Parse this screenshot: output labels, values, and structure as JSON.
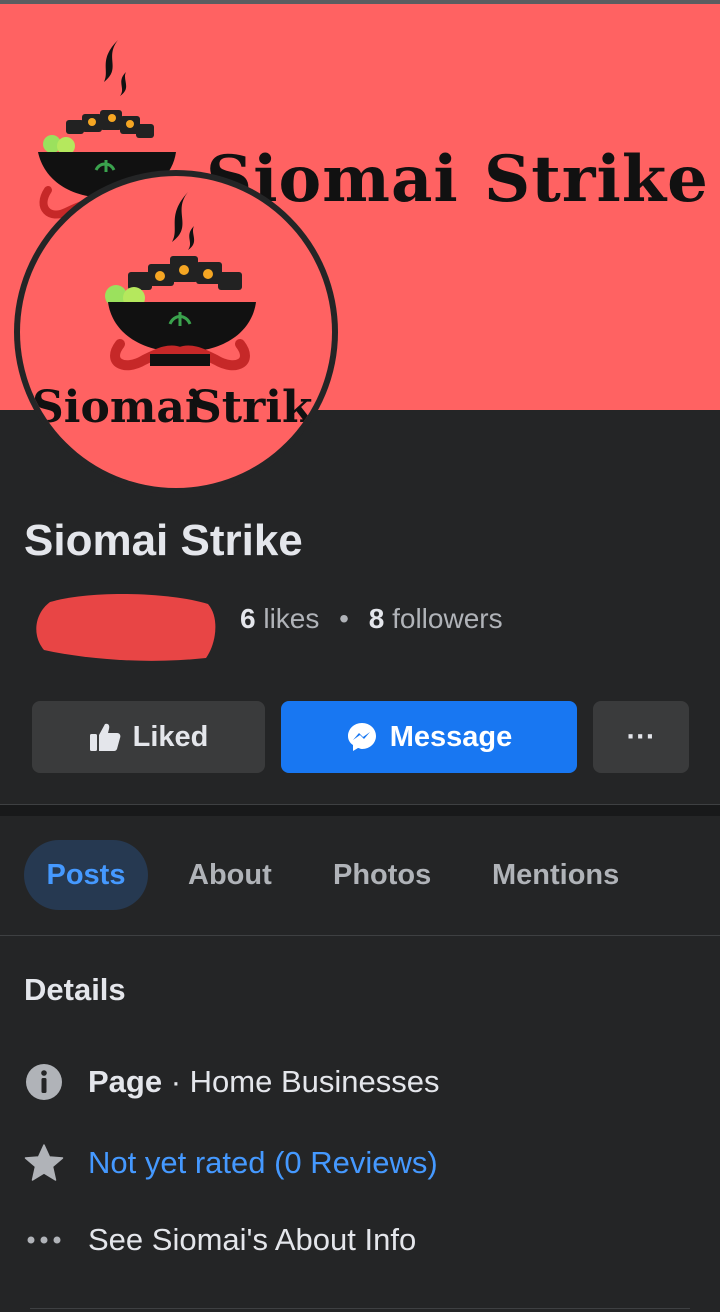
{
  "cover": {
    "brand_word1": "Siomai",
    "brand_word2": "Strike",
    "background_color": "#ff6262"
  },
  "profile": {
    "name": "Siomai Strike",
    "likes_count": "6",
    "likes_label": "likes",
    "followers_count": "8",
    "followers_label": "followers",
    "separator": "•"
  },
  "actions": {
    "liked_label": "Liked",
    "message_label": "Message",
    "more_label": "···"
  },
  "tabs": [
    {
      "label": "Posts",
      "active": true
    },
    {
      "label": "About",
      "active": false
    },
    {
      "label": "Photos",
      "active": false
    },
    {
      "label": "Mentions",
      "active": false
    }
  ],
  "details": {
    "title": "Details",
    "category_prefix": "Page",
    "category_value": " · Home Businesses",
    "rating_text": "Not yet rated (0 Reviews)",
    "about_link": "See Siomai's About Info",
    "icons": [
      "info-icon",
      "star-icon",
      "more-dots-icon"
    ]
  },
  "colors": {
    "accent": "#1877f2",
    "link": "#4599ff",
    "background": "#242526",
    "redaction": "#e84545"
  }
}
